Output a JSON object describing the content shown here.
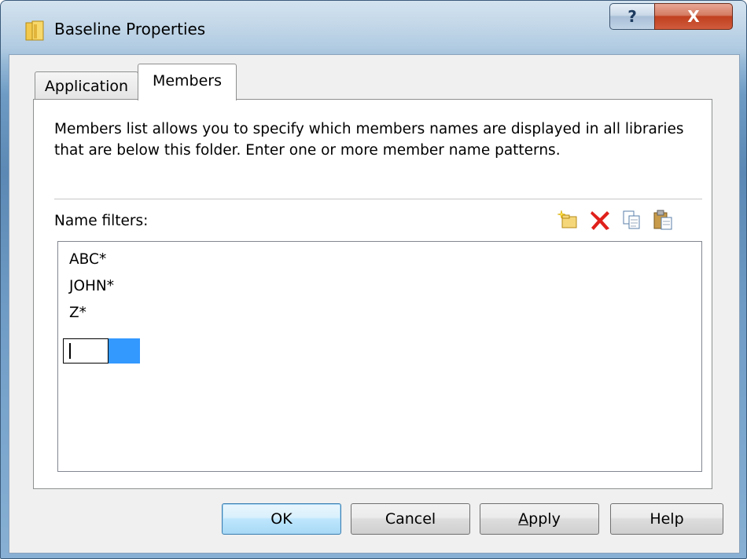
{
  "window": {
    "title": "Baseline Properties",
    "help_caption": "?",
    "close_caption": "X"
  },
  "tabs": [
    {
      "label": "Application",
      "selected": false
    },
    {
      "label": "Members",
      "selected": true
    }
  ],
  "members": {
    "description": "Members list allows you to specify which members names are displayed in all libraries that are below this folder.  Enter one or more member name patterns.",
    "filters_label": "Name filters:",
    "toolbar_icons": [
      "new-filter-icon",
      "delete-icon",
      "copy-icon",
      "paste-icon"
    ],
    "filters": [
      "ABC*",
      "JOHN*",
      "Z*"
    ],
    "new_filter_value": ""
  },
  "buttons": {
    "ok": "OK",
    "cancel": "Cancel",
    "apply": "Apply",
    "help": "Help"
  },
  "colors": {
    "selection": "#3399ff",
    "delete_icon": "#e0201b"
  }
}
